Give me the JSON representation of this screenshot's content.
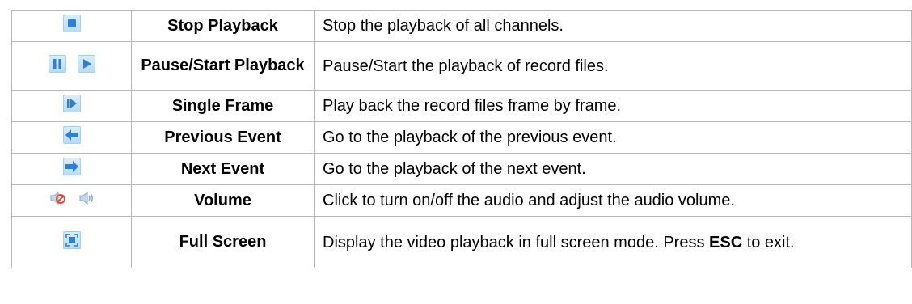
{
  "rows": [
    {
      "icons": [
        "stop-icon"
      ],
      "name": "Stop Playback",
      "desc": "Stop the playback of all channels."
    },
    {
      "icons": [
        "pause-icon",
        "play-icon"
      ],
      "name": "Pause/Start Playback",
      "desc": "Pause/Start the playback of record files."
    },
    {
      "icons": [
        "single-frame-icon"
      ],
      "name": "Single Frame",
      "desc": "Play back the record files frame by frame."
    },
    {
      "icons": [
        "previous-event-icon"
      ],
      "name": "Previous Event",
      "desc": "Go to the playback of the previous event."
    },
    {
      "icons": [
        "next-event-icon"
      ],
      "name": "Next Event",
      "desc": "Go to the playback of the next event."
    },
    {
      "icons": [
        "mute-icon",
        "volume-icon"
      ],
      "name": "Volume",
      "desc": "Click to turn on/off the audio and adjust the audio volume."
    },
    {
      "icons": [
        "full-screen-icon"
      ],
      "name": "Full Screen",
      "desc_pre": "Display the video playback in full screen mode. Press ",
      "desc_key": "ESC",
      "desc_post": " to exit."
    }
  ],
  "colors": {
    "icon_blue": "#2f7fd6",
    "grid": "#b9b9b9"
  }
}
